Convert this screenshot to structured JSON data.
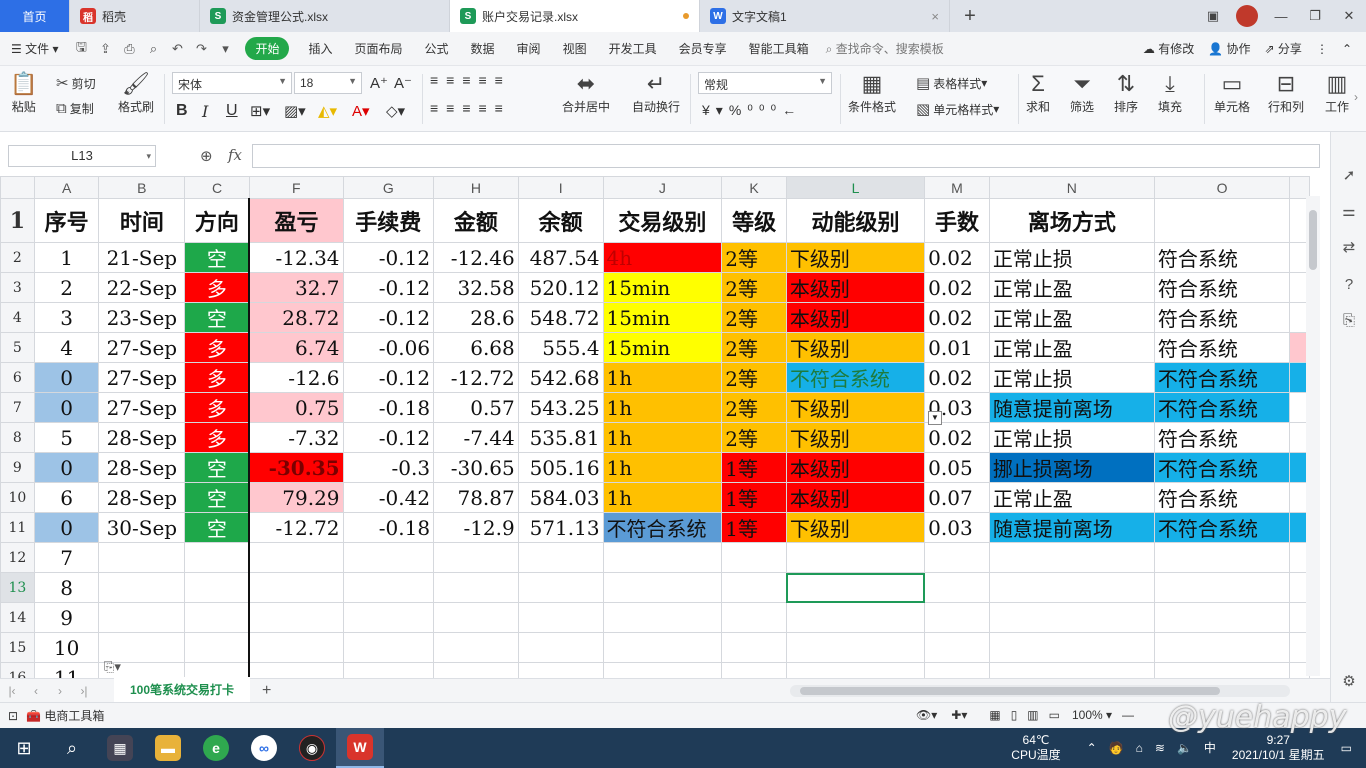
{
  "tabs": [
    {
      "label": "首页",
      "type": "home"
    },
    {
      "label": "稻壳",
      "icon": "docer-icon",
      "color": "#d9342b"
    },
    {
      "label": "资金管理公式.xlsx",
      "icon": "spreadsheet-icon",
      "color": "#1e9a58"
    },
    {
      "label": "账户交易记录.xlsx",
      "icon": "spreadsheet-icon",
      "color": "#1e9a58",
      "active": true
    },
    {
      "label": "文字文稿1",
      "icon": "writer-icon",
      "color": "#2d6fe6"
    }
  ],
  "menu": {
    "file": "文件",
    "items": [
      "开始",
      "插入",
      "页面布局",
      "公式",
      "数据",
      "审阅",
      "视图",
      "开发工具",
      "会员专享",
      "智能工具箱"
    ],
    "search": "查找命令、搜索模板",
    "right": [
      "有修改",
      "协作",
      "分享"
    ]
  },
  "ribbon": {
    "paste": "粘贴",
    "cut": "剪切",
    "copy": "复制",
    "format_painter": "格式刷",
    "font_name": "宋体",
    "font_size": "18",
    "number_format": "常规",
    "merge_center": "合并居中",
    "wrap": "自动换行",
    "cond_format": "条件格式",
    "table_style": "表格样式",
    "cell_style": "单元格样式",
    "sum": "求和",
    "filter": "筛选",
    "sort": "排序",
    "fill": "填充",
    "cells": "单元格",
    "rows_cols": "行和列",
    "worksheet": "工作"
  },
  "formula_bar": {
    "name_box": "L13",
    "fx": "fx",
    "formula": ""
  },
  "grid": {
    "columns": [
      "A",
      "B",
      "C",
      "F",
      "G",
      "H",
      "I",
      "J",
      "K",
      "L",
      "M",
      "N",
      "O"
    ],
    "selected_col": "L",
    "selected_row": "13",
    "header_row": [
      "序号",
      "时间",
      "方向",
      "盈亏",
      "手续费",
      "金额",
      "余额",
      "交易级别",
      "等级",
      "动能级别",
      "手数",
      "离场方式",
      ""
    ],
    "rows": [
      {
        "r": "2",
        "cells": [
          "1",
          "21-Sep",
          "空",
          "-12.34",
          "-0.12",
          "-12.46",
          "487.54",
          "4h",
          "2等",
          "下级别",
          "0.02",
          "正常止损",
          "符合系统"
        ]
      },
      {
        "r": "3",
        "cells": [
          "2",
          "22-Sep",
          "多",
          "32.7",
          "-0.12",
          "32.58",
          "520.12",
          "15min",
          "2等",
          "本级别",
          "0.02",
          "正常止盈",
          "符合系统"
        ]
      },
      {
        "r": "4",
        "cells": [
          "3",
          "23-Sep",
          "空",
          "28.72",
          "-0.12",
          "28.6",
          "548.72",
          "15min",
          "2等",
          "本级别",
          "0.02",
          "正常止盈",
          "符合系统"
        ]
      },
      {
        "r": "5",
        "cells": [
          "4",
          "27-Sep",
          "多",
          "6.74",
          "-0.06",
          "6.68",
          "555.4",
          "15min",
          "2等",
          "下级别",
          "0.01",
          "正常止盈",
          "符合系统"
        ]
      },
      {
        "r": "6",
        "cells": [
          "0",
          "27-Sep",
          "多",
          "-12.6",
          "-0.12",
          "-12.72",
          "542.68",
          "1h",
          "2等",
          "不符合系统",
          "0.02",
          "正常止损",
          "不符合系统"
        ]
      },
      {
        "r": "7",
        "cells": [
          "0",
          "27-Sep",
          "多",
          "0.75",
          "-0.18",
          "0.57",
          "543.25",
          "1h",
          "2等",
          "下级别",
          "0.03",
          "随意提前离场",
          "不符合系统"
        ]
      },
      {
        "r": "8",
        "cells": [
          "5",
          "28-Sep",
          "多",
          "-7.32",
          "-0.12",
          "-7.44",
          "535.81",
          "1h",
          "2等",
          "下级别",
          "0.02",
          "正常止损",
          "符合系统"
        ]
      },
      {
        "r": "9",
        "cells": [
          "0",
          "28-Sep",
          "空",
          "-30.35",
          "-0.3",
          "-30.65",
          "505.16",
          "1h",
          "1等",
          "本级别",
          "0.05",
          "挪止损离场",
          "不符合系统"
        ]
      },
      {
        "r": "10",
        "cells": [
          "6",
          "28-Sep",
          "空",
          "79.29",
          "-0.42",
          "78.87",
          "584.03",
          "1h",
          "1等",
          "本级别",
          "0.07",
          "正常止盈",
          "符合系统"
        ]
      },
      {
        "r": "11",
        "cells": [
          "0",
          "30-Sep",
          "空",
          "-12.72",
          "-0.18",
          "-12.9",
          "571.13",
          "不符合系统",
          "1等",
          "下级别",
          "0.03",
          "随意提前离场",
          "不符合系统"
        ]
      },
      {
        "r": "12",
        "cells": [
          "7",
          "",
          "",
          "",
          "",
          "",
          "",
          "",
          "",
          "",
          "",
          "",
          ""
        ]
      },
      {
        "r": "13",
        "cells": [
          "8",
          "",
          "",
          "",
          "",
          "",
          "",
          "",
          "",
          "",
          "",
          "",
          ""
        ]
      },
      {
        "r": "14",
        "cells": [
          "9",
          "",
          "",
          "",
          "",
          "",
          "",
          "",
          "",
          "",
          "",
          "",
          ""
        ]
      },
      {
        "r": "15",
        "cells": [
          "10",
          "",
          "",
          "",
          "",
          "",
          "",
          "",
          "",
          "",
          "",
          "",
          ""
        ]
      },
      {
        "r": "16",
        "cells": [
          "11",
          "",
          "",
          "",
          "",
          "",
          "",
          "",
          "",
          "",
          "",
          "",
          ""
        ]
      }
    ]
  },
  "colors": {
    "red": "#ff0000",
    "green": "#1ea84a",
    "pink": "#ffc7ce",
    "yellow": "#ffff00",
    "orange": "#ffc000",
    "cyan": "#16b0e8",
    "blue": "#0070c0",
    "lightblue": "#9dc3e6",
    "steelblue": "#5b9bd5"
  },
  "sheet_tab": "100笔系统交易打卡",
  "status": {
    "toolbox": "电商工具箱",
    "zoom": "100%"
  },
  "taskbar": {
    "temp": "64℃",
    "temp_label": "CPU温度",
    "ime": "中",
    "time": "9:27",
    "date": "2021/10/1 星期五"
  },
  "watermark": "@yuehappy"
}
